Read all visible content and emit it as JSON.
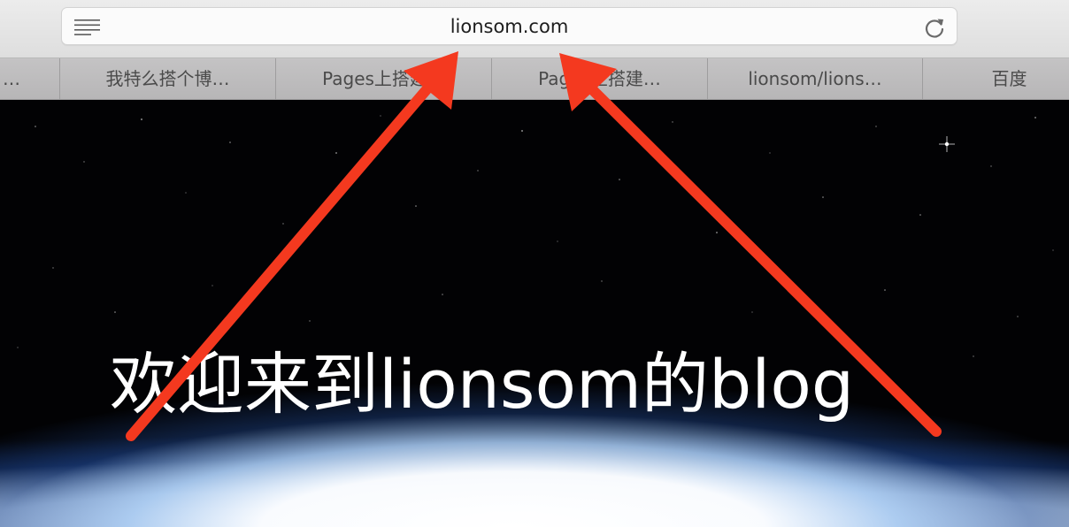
{
  "browser": {
    "address_bar": {
      "url": "lionsom.com",
      "reader_icon": "reader-lines-icon",
      "reload_icon": "reload-icon"
    },
    "tabs": [
      {
        "label": "…"
      },
      {
        "label": "我特么搭个博…"
      },
      {
        "label": "Pages上搭建…"
      },
      {
        "label": "Pages上搭建…"
      },
      {
        "label": "lionsom/lions…"
      },
      {
        "label": "百度"
      }
    ]
  },
  "page": {
    "hero_title": "欢迎来到lionsom的blog",
    "background": "earth-horizon-space"
  },
  "annotation": {
    "arrow_color": "#f4391f"
  }
}
